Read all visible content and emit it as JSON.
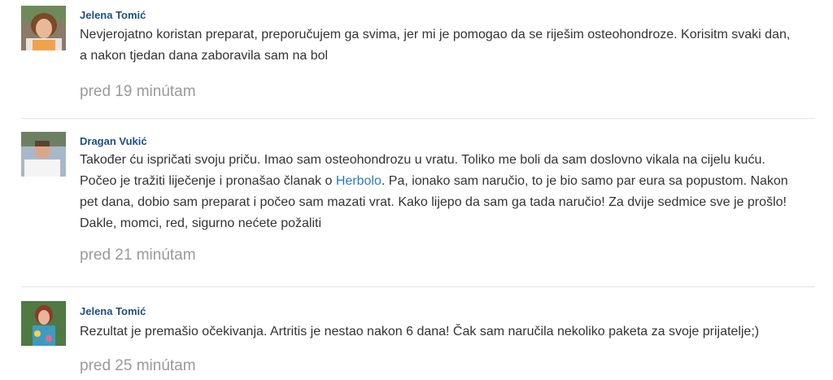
{
  "comments": [
    {
      "author": "Jelena Tomić",
      "text": "Nevjerojatno koristan preparat, preporučujem ga svima, jer mi je pomogao da se riješim osteohondroze. Korisitm svaki dan, a nakon tjedan dana zaboravila sam na bol",
      "time": "pred 19 minútam"
    },
    {
      "author": "Dragan Vukić",
      "text_before": "Također ću ispričati svoju priču. Imao sam osteohondrozu u vratu. Toliko me boli da sam doslovno vikala na cijelu kuću. Počeo je tražiti liječenje i pronašao članak o ",
      "link": "Herbolo",
      "text_after": ". Pa, ionako sam naručio, to je bio samo par eura sa popustom. Nakon pet dana, dobio sam preparat i počeo sam mazati vrat. Kako lijepo da sam ga tada naručio! Za dvije sedmice sve je prošlo! Dakle, momci, red, sigurno nećete požaliti",
      "time": "pred 21 minútam"
    },
    {
      "author": "Jelena Tomić",
      "text": "Rezultat je premašio očekivanja. Artritis je nestao nakon 6 dana! Čak sam naručila nekoliko paketa za svoje prijatelje;)",
      "time": "pred 25 minútam"
    }
  ]
}
